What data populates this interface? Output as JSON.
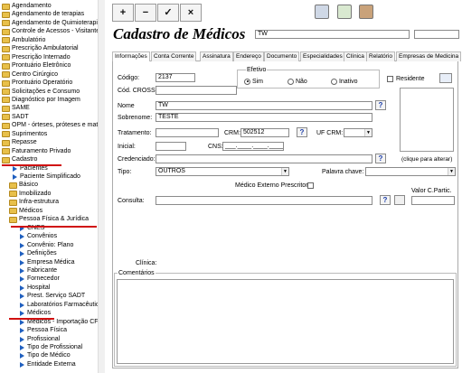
{
  "sidebar": {
    "items": [
      {
        "label": "Agendamento",
        "icon": "folder"
      },
      {
        "label": "Agendamento de terapias",
        "icon": "folder"
      },
      {
        "label": "Agendamento de Quimioterapia",
        "icon": "folder"
      },
      {
        "label": "Controle de Acessos - Visitante",
        "icon": "folder"
      },
      {
        "label": "Ambulatório",
        "icon": "folder"
      },
      {
        "label": "Prescrição Ambulatorial",
        "icon": "folder"
      },
      {
        "label": "Prescrição Internado",
        "icon": "folder"
      },
      {
        "label": "Prontuário Eletrônico",
        "icon": "folder"
      },
      {
        "label": "Centro Cirúrgico",
        "icon": "folder"
      },
      {
        "label": "Prontuário Operatório",
        "icon": "folder"
      },
      {
        "label": "Solicitações e Consumo",
        "icon": "folder"
      },
      {
        "label": "Diagnóstico por Imagem",
        "icon": "folder"
      },
      {
        "label": "SAME",
        "icon": "folder"
      },
      {
        "label": "SADT",
        "icon": "folder"
      },
      {
        "label": "OPM - órteses, próteses e mater",
        "icon": "folder"
      },
      {
        "label": "Suprimentos",
        "icon": "folder"
      },
      {
        "label": "Repasse",
        "icon": "folder"
      },
      {
        "label": "Faturamento Privado",
        "icon": "folder"
      },
      {
        "label": "Cadastro",
        "icon": "folder"
      },
      {
        "label": "Pacientes",
        "icon": "triangle"
      },
      {
        "label": "Paciente Simplificado",
        "icon": "triangle"
      },
      {
        "label": "Básico",
        "icon": "folder"
      },
      {
        "label": "Imobilizado",
        "icon": "folder"
      },
      {
        "label": "Infra-estrutura",
        "icon": "folder"
      },
      {
        "label": "Médicos",
        "icon": "folder"
      },
      {
        "label": "Pessoa Física & Jurídica",
        "icon": "folder"
      },
      {
        "label": "CNES",
        "icon": "triangle"
      },
      {
        "label": "Convênios",
        "icon": "triangle"
      },
      {
        "label": "Convênio: Plano",
        "icon": "triangle"
      },
      {
        "label": "Definições",
        "icon": "triangle"
      },
      {
        "label": "Empresa Médica",
        "icon": "triangle"
      },
      {
        "label": "Fabricante",
        "icon": "triangle"
      },
      {
        "label": "Fornecedor",
        "icon": "triangle"
      },
      {
        "label": "Hospital",
        "icon": "triangle"
      },
      {
        "label": "Prest. Serviço SADT",
        "icon": "triangle"
      },
      {
        "label": "Laboratórios Farmacêutic",
        "icon": "triangle"
      },
      {
        "label": "Médicos",
        "icon": "triangle"
      },
      {
        "label": "Médicos - Importação CF",
        "icon": "triangle"
      },
      {
        "label": "Pessoa Física",
        "icon": "triangle"
      },
      {
        "label": "Profissional",
        "icon": "triangle"
      },
      {
        "label": "Tipo de Profissional",
        "icon": "triangle"
      },
      {
        "label": "Tipo de Médico",
        "icon": "triangle"
      },
      {
        "label": "Entidade Externa",
        "icon": "triangle"
      }
    ]
  },
  "toolbar": {
    "add": "+",
    "remove": "−",
    "confirm": "✓",
    "cancel": "×"
  },
  "title": "Cadastro de Médicos",
  "title_field": "TW",
  "tabs": [
    "Informações",
    "Conta Corrente",
    "Assinatura",
    "Endereço",
    "Documento",
    "Especialidades",
    "Clínica",
    "Relatório",
    "Empresas de Medicina"
  ],
  "form": {
    "codigo_label": "Código:",
    "codigo": "2137",
    "cross_label": "Cód. CROSS:",
    "efetivo_label": "Efetivo",
    "opt_sim": "Sim",
    "opt_nao": "Não",
    "opt_inativo": "Inativo",
    "residente_label": "Residente",
    "nome_label": "Nome",
    "nome": "TW",
    "sobrenome_label": "Sobrenome:",
    "sobrenome": "TESTE",
    "tratamento_label": "Tratamento:",
    "crm_label": "CRM:",
    "crm": "502512",
    "ufcrm_label": "UF CRM:",
    "inicial_label": "Inicial:",
    "cns_label": "CNS:",
    "cns": "___.____.____.____",
    "credenciado_label": "Credenciado:",
    "foto_hint": "(clique para alterar)",
    "tipo_label": "Tipo:",
    "tipo": "OUTROS",
    "palavra_label": "Palavra chave:",
    "externo_label": "Médico Externo Prescritor:",
    "valor_label": "Valor C.Partic.",
    "consulta_label": "Consulta:",
    "clinica_label": "Clínica:",
    "comentarios_label": "Comentários",
    "help": "?"
  }
}
